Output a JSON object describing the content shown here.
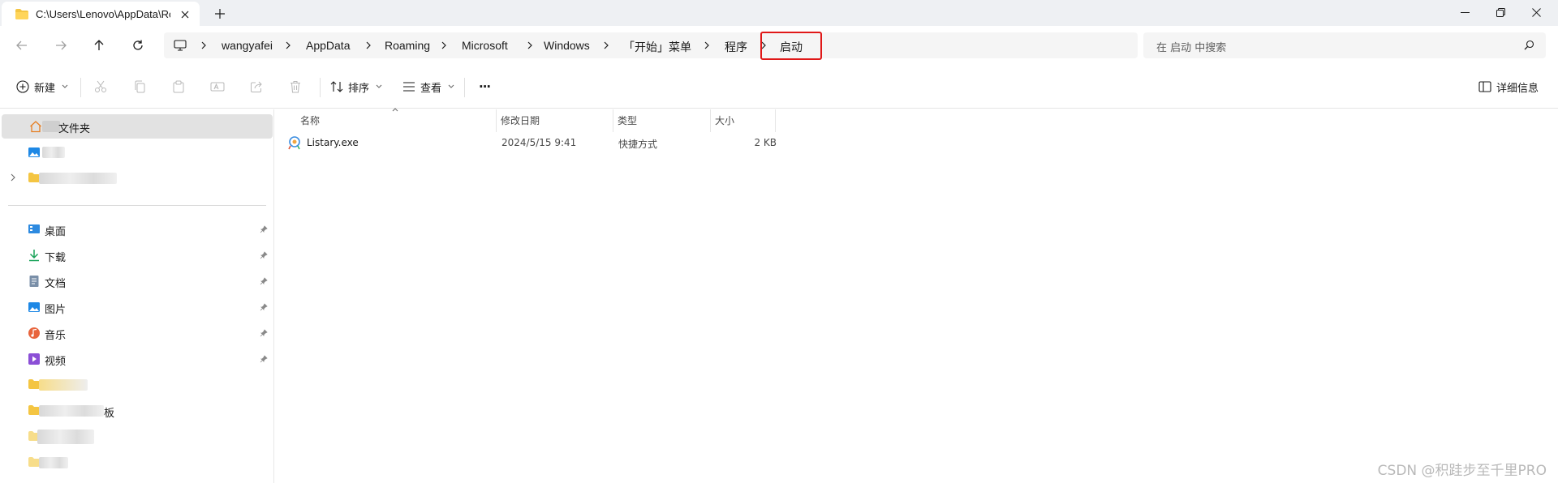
{
  "tab": {
    "title": "C:\\Users\\Lenovo\\AppData\\Roaming"
  },
  "address": {
    "crumbs": [
      "wangyafei",
      "AppData",
      "Roaming",
      "Microsoft",
      "Windows",
      "「开始」菜单",
      "程序",
      "启动"
    ]
  },
  "search": {
    "placeholder": "在 启动 中搜索"
  },
  "toolbar": {
    "new_label": "新建",
    "sort_label": "排序",
    "view_label": "查看",
    "more_label": "···",
    "details_label": "详细信息"
  },
  "sidebar": {
    "top_items": [
      "文件夹"
    ],
    "quick_access": [
      {
        "label": "桌面",
        "icon": "desktop-icon"
      },
      {
        "label": "下载",
        "icon": "download-icon"
      },
      {
        "label": "文档",
        "icon": "documents-icon"
      },
      {
        "label": "图片",
        "icon": "pictures-icon"
      },
      {
        "label": "音乐",
        "icon": "music-icon"
      },
      {
        "label": "视频",
        "icon": "videos-icon"
      }
    ],
    "partial_labels": [
      "板"
    ]
  },
  "columns": {
    "name": "名称",
    "date": "修改日期",
    "type": "类型",
    "size": "大小"
  },
  "files": [
    {
      "name": "Listary.exe",
      "date": "2024/5/15 9:41",
      "type": "快捷方式",
      "size": "2 KB"
    }
  ],
  "watermark": "CSDN @积跬步至千里PRO",
  "colors": {
    "highlight": "#e01818",
    "folder": "#f4c542",
    "selected": "#e2e2e2"
  }
}
